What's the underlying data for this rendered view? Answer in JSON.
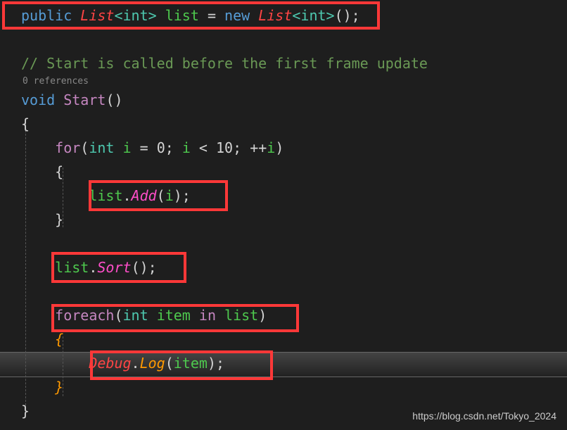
{
  "code": {
    "line1": {
      "public": "public",
      "List1": "List",
      "intType1": "<int>",
      "listVar": " list",
      "equals": " = ",
      "new": "new",
      "space": " ",
      "List2": "List",
      "intType2": "<int>",
      "parens": "();"
    },
    "comment": "// Start is called before the first frame update",
    "references": "0 references",
    "line4": {
      "void": "void",
      "space": " ",
      "Start": "Start",
      "parens": "()"
    },
    "brace_open": "{",
    "line6": {
      "indent": "    ",
      "for": "for",
      "paren": "(",
      "int": "int",
      "var": " i ",
      "eq": "= ",
      "zero": "0",
      "semi1": "; ",
      "var2": "i ",
      "lt": "< ",
      "ten": "10",
      "semi2": "; ",
      "inc": "++",
      "var3": "i",
      "close": ")"
    },
    "line7_brace": "    {",
    "line8": {
      "indent": "        ",
      "list": "list",
      "dot": ".",
      "Add": "Add",
      "paren1": "(",
      "i": "i",
      "paren2": ");"
    },
    "line9_brace": "    }",
    "line11": {
      "indent": "    ",
      "list": "list",
      "dot": ".",
      "Sort": "Sort",
      "parens": "();"
    },
    "line13": {
      "indent": "    ",
      "foreach": "foreach",
      "paren": "(",
      "int": "int",
      "space": " ",
      "item": "item",
      "space2": " ",
      "in": "in",
      "space3": " ",
      "list": "list",
      "close": ")"
    },
    "line14_brace": "    {",
    "line15": {
      "indent": "        ",
      "Debug": "Debug",
      "dot": ".",
      "Log": "Log",
      "paren1": "(",
      "item": "item",
      "paren2": ");"
    },
    "line16_brace": "    }",
    "brace_close": "}"
  },
  "watermark": "https://blog.csdn.net/Tokyo_2024"
}
